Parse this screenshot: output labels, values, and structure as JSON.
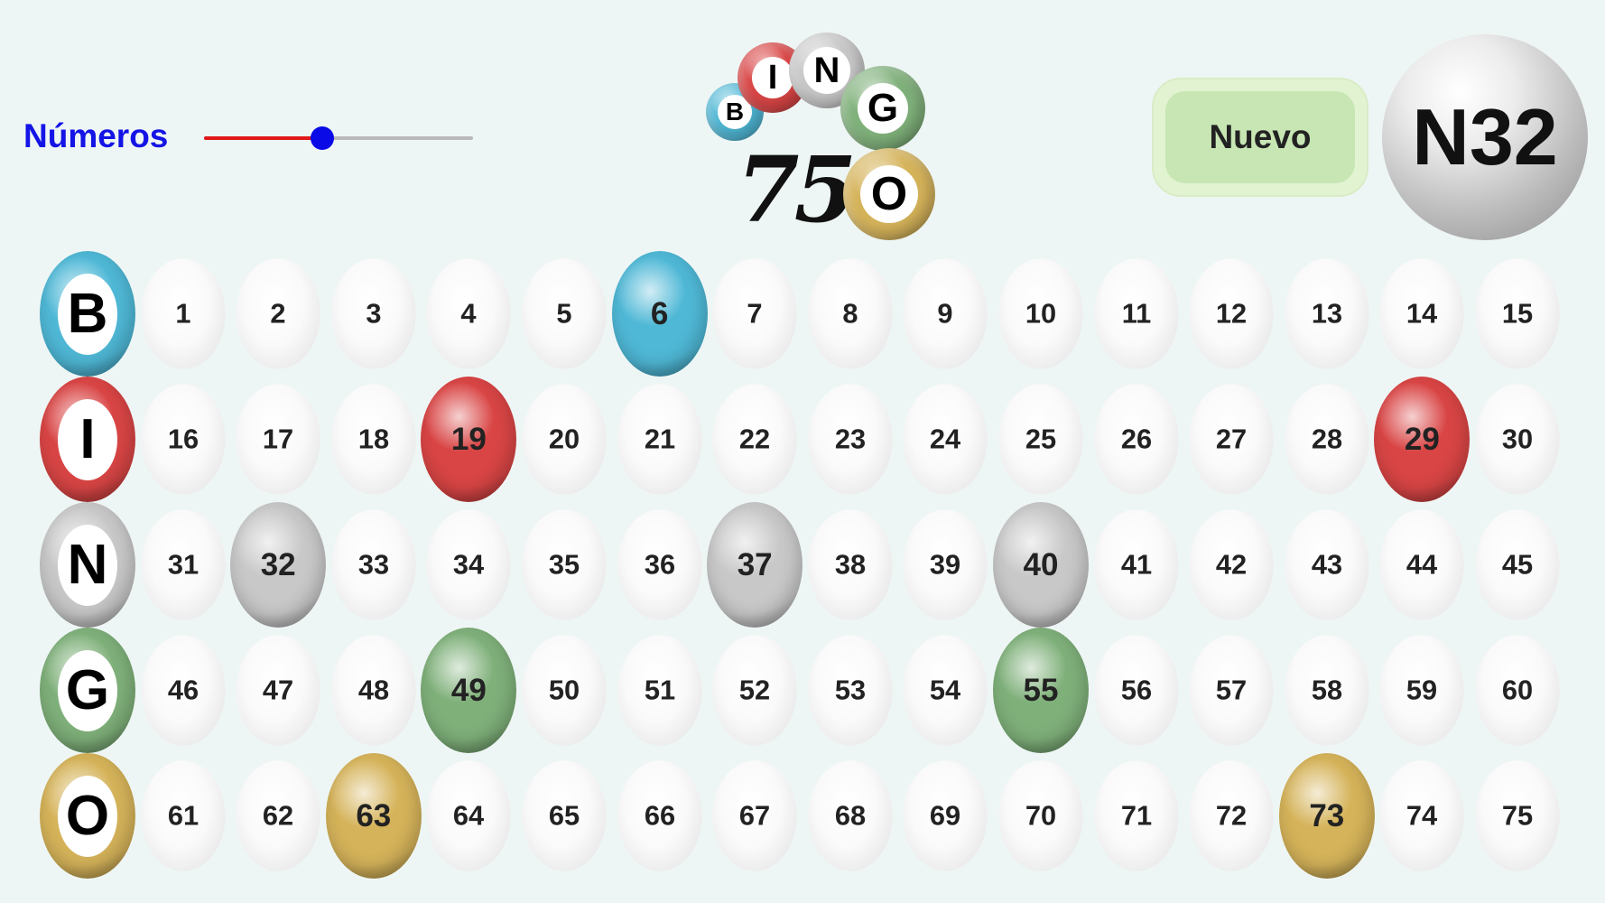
{
  "header": {
    "numeros_label": "Números",
    "slider": {
      "value_fraction": 0.44,
      "thumb_color": "#0a0ae6",
      "fill_color": "#e01818",
      "track_color": "#b9b9b9"
    },
    "logo": {
      "letters": [
        "B",
        "I",
        "N",
        "G",
        "O"
      ],
      "number": "75"
    },
    "nuevo_button_label": "Nuevo",
    "current_ball": "N32"
  },
  "colors": {
    "B": "#4fb8d6",
    "I": "#d94545",
    "N": "#c8c8c8",
    "G": "#7fb07a",
    "O": "#d5b35a",
    "plain": "#f6f6f6"
  },
  "board": {
    "rows": [
      {
        "letter": "B",
        "numbers": [
          1,
          2,
          3,
          4,
          5,
          6,
          7,
          8,
          9,
          10,
          11,
          12,
          13,
          14,
          15
        ],
        "called": [
          6
        ]
      },
      {
        "letter": "I",
        "numbers": [
          16,
          17,
          18,
          19,
          20,
          21,
          22,
          23,
          24,
          25,
          26,
          27,
          28,
          29,
          30
        ],
        "called": [
          19,
          29
        ]
      },
      {
        "letter": "N",
        "numbers": [
          31,
          32,
          33,
          34,
          35,
          36,
          37,
          38,
          39,
          40,
          41,
          42,
          43,
          44,
          45
        ],
        "called": [
          32,
          37,
          40
        ]
      },
      {
        "letter": "G",
        "numbers": [
          46,
          47,
          48,
          49,
          50,
          51,
          52,
          53,
          54,
          55,
          56,
          57,
          58,
          59,
          60
        ],
        "called": [
          49,
          55
        ]
      },
      {
        "letter": "O",
        "numbers": [
          61,
          62,
          63,
          64,
          65,
          66,
          67,
          68,
          69,
          70,
          71,
          72,
          73,
          74,
          75
        ],
        "called": [
          63,
          73
        ]
      }
    ]
  },
  "icons": {
    "slider_thumb": "circle",
    "ball": "bingo-ball"
  }
}
